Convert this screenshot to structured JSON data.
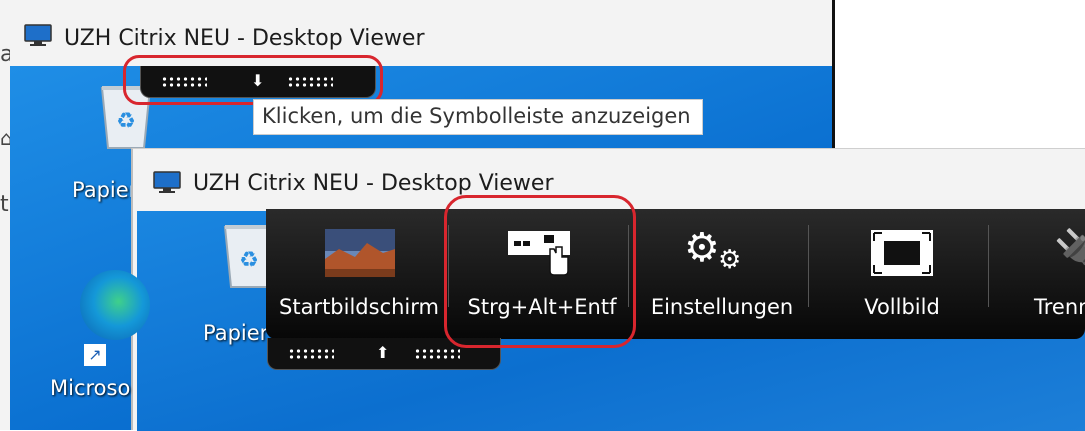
{
  "background": {
    "chars": [
      "a",
      "t"
    ]
  },
  "window1": {
    "title": "UZH Citrix NEU - Desktop Viewer",
    "tooltip": "Klicken, um die Symbolleiste anzuzeigen",
    "desktop_label": "Papier"
  },
  "window2": {
    "title": "UZH Citrix NEU - Desktop Viewer",
    "desktop_labels": {
      "recycle": "Papier",
      "edge": "Microso"
    },
    "toolbar": {
      "items": [
        {
          "label": "Startbildschirm",
          "icon": "desert-landscape-icon"
        },
        {
          "label": "Strg+Alt+Entf",
          "icon": "keyboard-click-icon"
        },
        {
          "label": "Einstellungen",
          "icon": "gears-icon"
        },
        {
          "label": "Vollbild",
          "icon": "fullscreen-icon"
        },
        {
          "label": "Trenn",
          "icon": "plug-icon"
        }
      ]
    }
  },
  "colors": {
    "highlight": "#d8262e",
    "desktop": "#0a6fd0",
    "toolbar": "#111111"
  }
}
